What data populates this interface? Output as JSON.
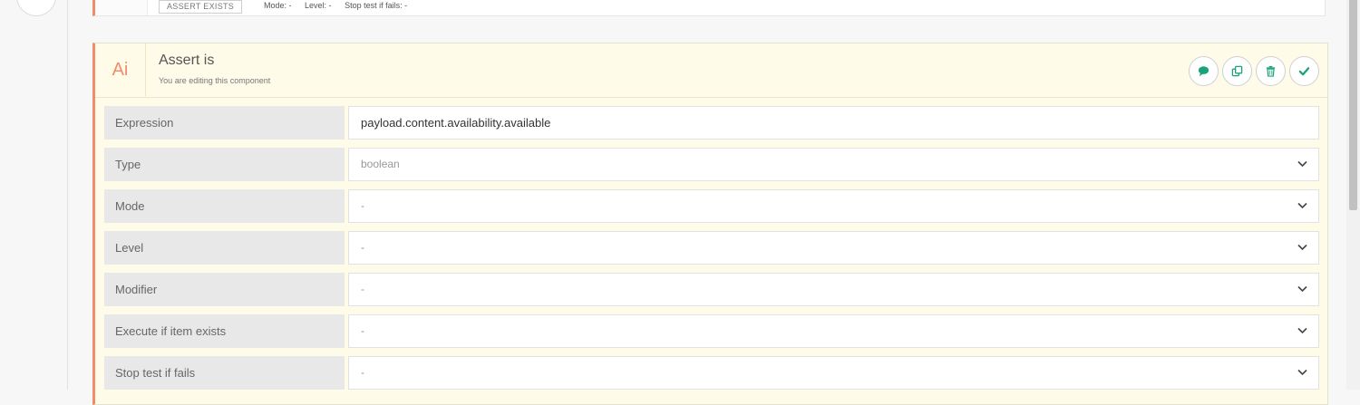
{
  "prev_component": {
    "badge": "ASSERT EXISTS",
    "mode": "Mode: -",
    "level": "Level: -",
    "stop": "Stop test if fails: -"
  },
  "component": {
    "icon_text": "Ai",
    "title": "Assert is",
    "subtitle": "You are editing this component",
    "actions": [
      {
        "icon": "comment-icon"
      },
      {
        "icon": "duplicate-icon"
      },
      {
        "icon": "trash-icon"
      },
      {
        "icon": "check-icon"
      }
    ]
  },
  "fields": [
    {
      "label": "Expression",
      "value": "payload.content.availability.available",
      "kind": "input"
    },
    {
      "label": "Type",
      "value": "boolean",
      "kind": "select"
    },
    {
      "label": "Mode",
      "value": "-",
      "kind": "select"
    },
    {
      "label": "Level",
      "value": "-",
      "kind": "select"
    },
    {
      "label": "Modifier",
      "value": "-",
      "kind": "select"
    },
    {
      "label": "Execute if item exists",
      "value": "-",
      "kind": "select"
    },
    {
      "label": "Stop test if fails",
      "value": "-",
      "kind": "select"
    }
  ],
  "colors": {
    "accent": "#f08c6c",
    "action_icon": "#1aa37a",
    "card_bg": "#fffbe9"
  }
}
